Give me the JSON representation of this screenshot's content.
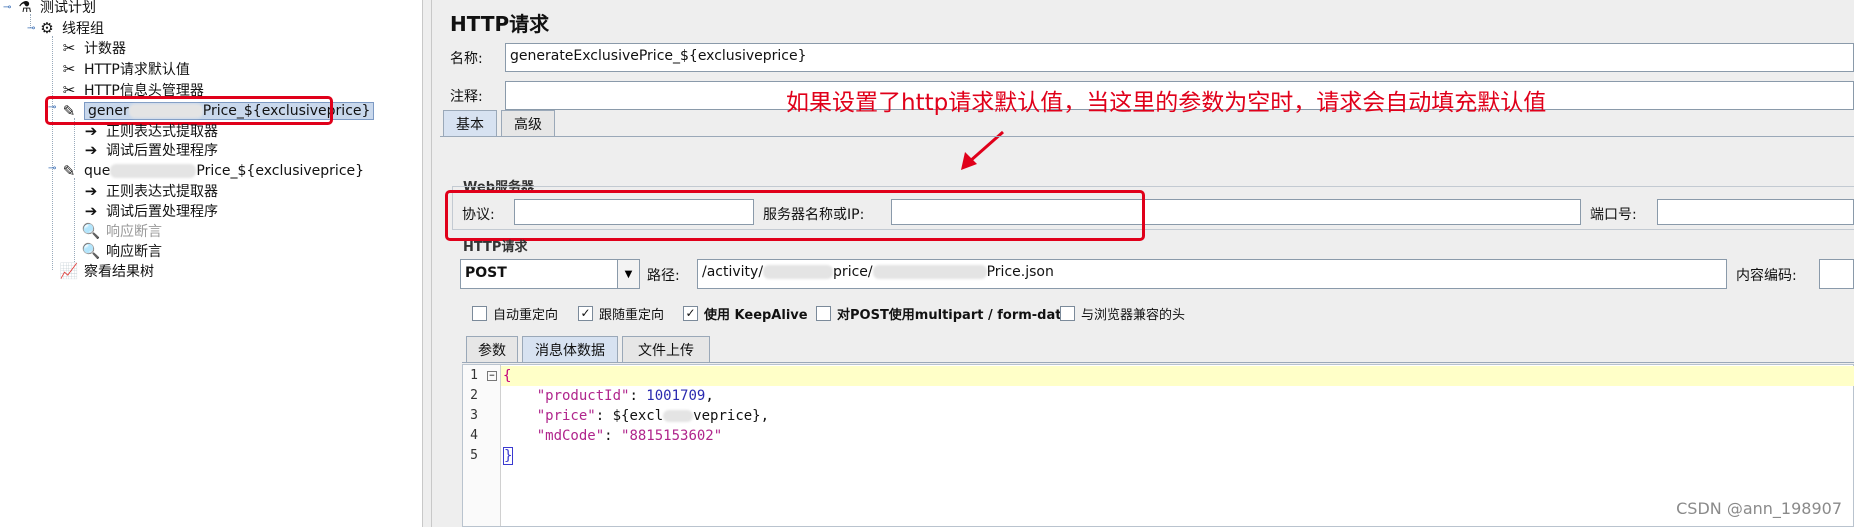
{
  "tree": {
    "items": [
      {
        "label": "测试计划",
        "icon": "test-plan-icon"
      },
      {
        "label": "线程组",
        "icon": "thread-group-gear-icon"
      },
      {
        "label": "计数器",
        "icon": "config-tools-icon"
      },
      {
        "label": "HTTP请求默认值",
        "icon": "config-tools-icon"
      },
      {
        "label": "HTTP信息头管理器",
        "icon": "config-tools-icon"
      },
      {
        "label_start": "gener",
        "label_end": "Price_${exclusiveprice}",
        "icon": "http-sampler-pipette-icon"
      },
      {
        "label": "正则表达式提取器",
        "icon": "post-processor-arrow-icon"
      },
      {
        "label": "调试后置处理程序",
        "icon": "post-processor-arrow-icon"
      },
      {
        "label_start": "que",
        "label_end": "Price_${exclusiveprice}",
        "icon": "http-sampler-pipette-icon"
      },
      {
        "label": "正则表达式提取器",
        "icon": "post-processor-arrow-icon"
      },
      {
        "label": "调试后置处理程序",
        "icon": "post-processor-arrow-icon"
      },
      {
        "label": "响应断言",
        "icon": "assertion-magnifier-icon"
      },
      {
        "label": "响应断言",
        "icon": "assertion-magnifier-icon"
      },
      {
        "label": "察看结果树",
        "icon": "listener-chart-icon"
      }
    ]
  },
  "panel": {
    "title": "HTTP请求",
    "name_label": "名称:",
    "name_value": "generateExclusivePrice_${exclusiveprice}",
    "comment_label": "注释:",
    "comment_value": "",
    "annotation": "如果设置了http请求默认值，当这里的参数为空时，请求会自动填充默认值",
    "tabs": [
      "基本",
      "高级"
    ],
    "web_server": {
      "legend": "Web服务器",
      "protocol_label": "协议:",
      "protocol_value": "",
      "server_label": "服务器名称或IP:",
      "server_value": "",
      "port_label": "端口号:",
      "port_value": ""
    },
    "http_request": {
      "legend": "HTTP请求",
      "method": "POST",
      "path_label": "路径:",
      "path_start": "/activity/",
      "path_mid": "price/",
      "path_end": "Price.json",
      "encoding_label": "内容编码:",
      "encoding_value": ""
    },
    "checkboxes": [
      {
        "label": "自动重定向",
        "checked": false
      },
      {
        "label": "跟随重定向",
        "checked": true
      },
      {
        "label": "使用 KeepAlive",
        "checked": true
      },
      {
        "label": "对POST使用multipart / form-data",
        "checked": false
      },
      {
        "label": "与浏览器兼容的头",
        "checked": false
      }
    ],
    "body_tabs": [
      "参数",
      "消息体数据",
      "文件上传"
    ],
    "body_lines": [
      "1",
      "2",
      "3",
      "4",
      "5"
    ],
    "code": {
      "open_brace": "{",
      "k1": "\"productId\"",
      "v1": "1001709",
      "k2": "\"price\"",
      "v2_start": "${excl",
      "v2_end": "veprice}",
      "k3": "\"mdCode\"",
      "v3": "\"8815153602\"",
      "close_brace": "}"
    }
  },
  "watermark": "CSDN @ann_198907",
  "colors": {
    "highlight_red": "#e0001a",
    "current_line": "#ffffc8",
    "selection": "#c9d8ec"
  }
}
